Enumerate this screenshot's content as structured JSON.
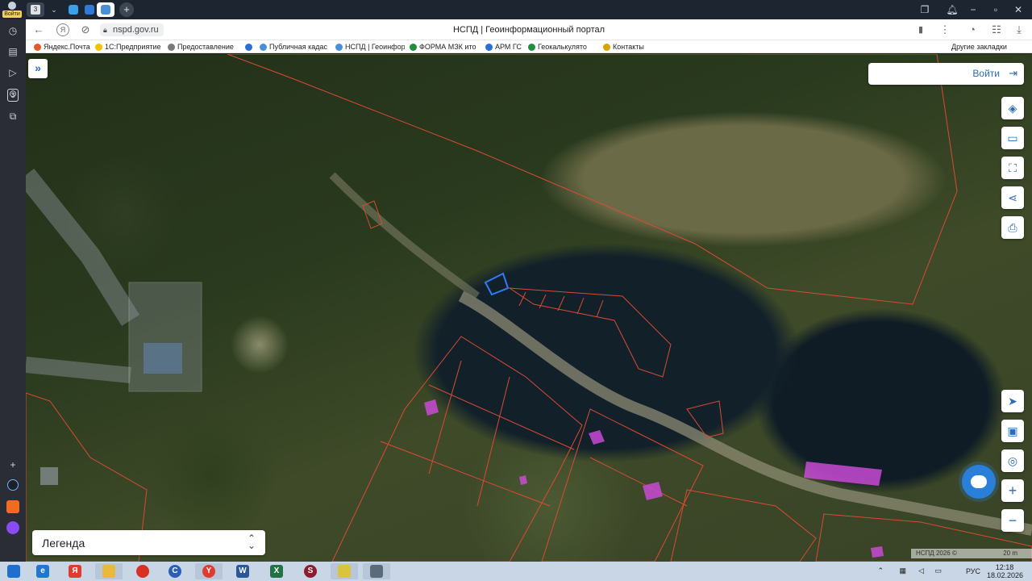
{
  "browser": {
    "title": "НСПД | Геоинформационный портал",
    "url": "nspd.gov.ru",
    "profile_badge": "Войти",
    "tab_count_badge": "3",
    "sidebar_badge": "3",
    "bookmarks": [
      {
        "label": "Яндекс.Почта",
        "icon_color": "#e05a2b"
      },
      {
        "label": "1С:Предприятие",
        "icon_color": "#f2c400"
      },
      {
        "label": "Предоставление",
        "icon_color": "#7a7a7a"
      },
      {
        "label": "",
        "icon_color": "#2b6fd6"
      },
      {
        "label": "Публичная кадас",
        "icon_color": "#4a90d9"
      },
      {
        "label": "НСПД | Геоинфор",
        "icon_color": "#4a90d9"
      },
      {
        "label": "ФОРМА МЗК ито",
        "icon_color": "#1e8e3e"
      },
      {
        "label": "АРМ ГС",
        "icon_color": "#2b6fd6"
      },
      {
        "label": "Геокалькулято",
        "icon_color": "#1e8e3e"
      },
      {
        "label": "Контакты",
        "icon_color": "#d9a400"
      }
    ],
    "other_bookmarks": "Другие закладки"
  },
  "map": {
    "login_label": "Войти",
    "legend_label": "Легенда",
    "attribution": "НСПД 2026 ©",
    "scale": "20 m",
    "toolbar_icons": [
      "layers-icon",
      "ruler-icon",
      "select-area-icon",
      "share-icon",
      "print-icon"
    ],
    "nav_icons": [
      "locate-icon",
      "minimap-icon",
      "search-location-icon"
    ],
    "zoom_in": "+",
    "zoom_out": "−",
    "colors": {
      "parcel_border": "#d94a34",
      "selected_parcel": "#2f7cf6",
      "building_fill": "#c94ad6",
      "accent": "#2c6db5"
    }
  },
  "taskbar": {
    "apps": [
      {
        "name": "ie",
        "glyph": "e",
        "color": "#1f77d0"
      },
      {
        "name": "yandex",
        "glyph": "Я",
        "color": "#e03b2f"
      },
      {
        "name": "explorer",
        "glyph": "",
        "color": "#e8b93b"
      },
      {
        "name": "chrome",
        "glyph": "",
        "color": "#d93025"
      },
      {
        "name": "app-c",
        "glyph": "C",
        "color": "#2b5fb8"
      },
      {
        "name": "yandex-browser",
        "glyph": "Y",
        "color": "#e03b2f"
      },
      {
        "name": "word",
        "glyph": "W",
        "color": "#2b579a"
      },
      {
        "name": "excel",
        "glyph": "X",
        "color": "#217346"
      },
      {
        "name": "app-s",
        "glyph": "S",
        "color": "#8b1c2b"
      },
      {
        "name": "notes",
        "glyph": "",
        "color": "#d9c43a"
      },
      {
        "name": "app-person",
        "glyph": "",
        "color": "#5a6b7a"
      }
    ],
    "language": "РУС",
    "time": "12:18",
    "date": "18.02.2026"
  }
}
